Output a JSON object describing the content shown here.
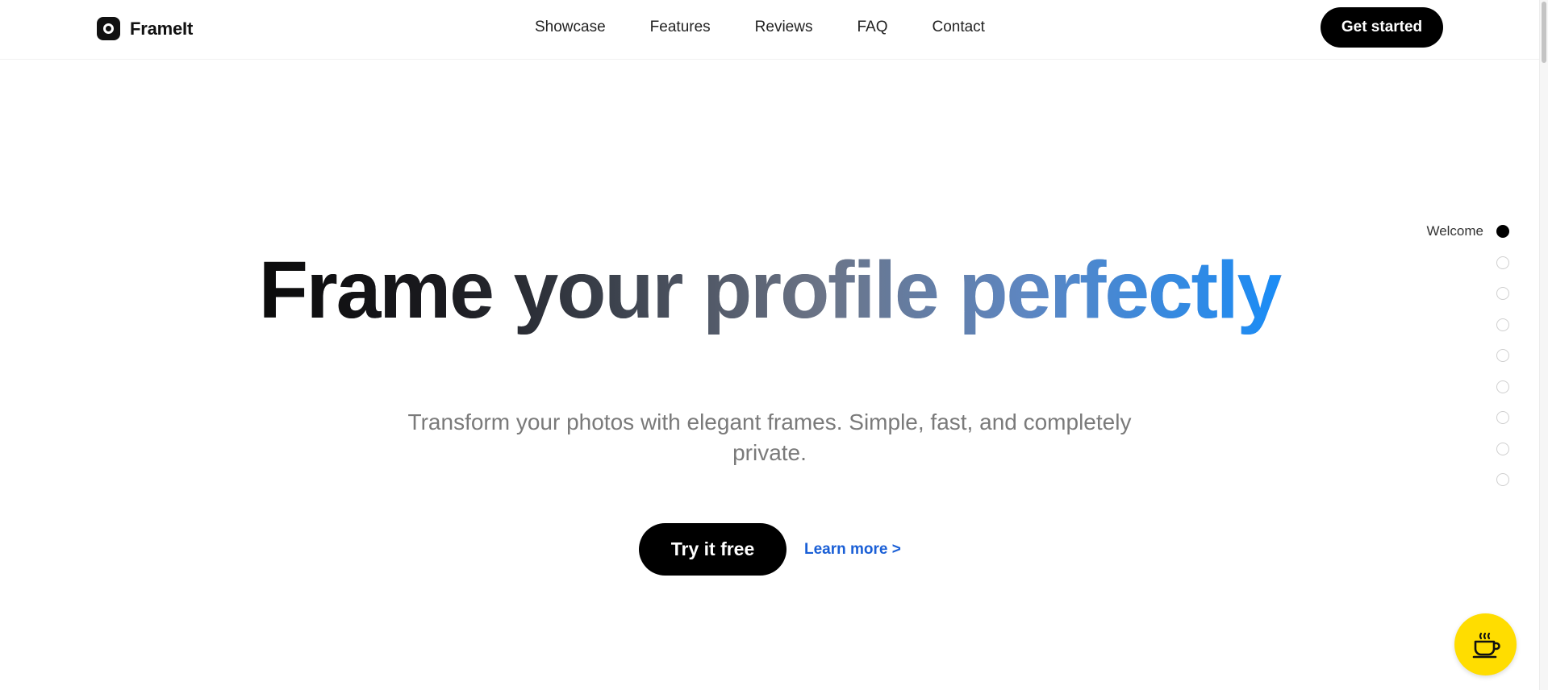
{
  "header": {
    "brand": "FrameIt",
    "nav": [
      "Showcase",
      "Features",
      "Reviews",
      "FAQ",
      "Contact"
    ],
    "cta_label": "Get started"
  },
  "hero": {
    "title": "Frame your profile perfectly",
    "subtitle": "Transform your photos with elegant frames. Simple, fast, and completely private.",
    "primary_cta": "Try it free",
    "secondary_cta": "Learn more >"
  },
  "side_nav": {
    "active_label": "Welcome",
    "sections": 9,
    "active_index": 0
  },
  "coffee": {
    "icon": "coffee-cup-icon",
    "color": "#ffdd00"
  },
  "colors": {
    "accent_blue": "#1a8cf6",
    "link_blue": "#1a5fd6",
    "button_black": "#000000"
  }
}
